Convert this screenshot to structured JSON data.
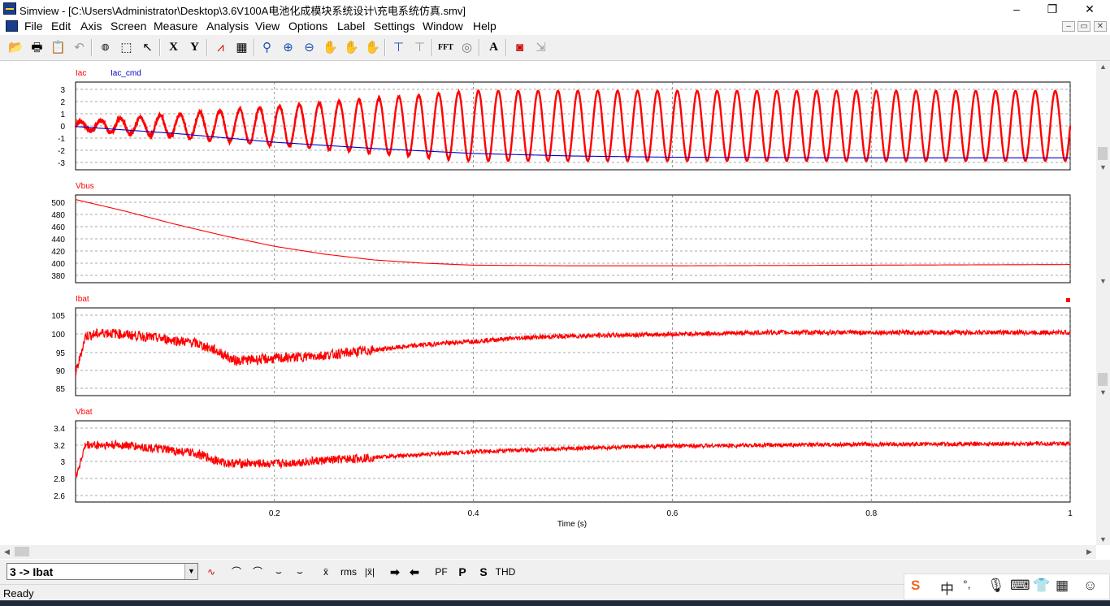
{
  "window": {
    "title": "Simview - [C:\\Users\\Administrator\\Desktop\\3.6V100A电池化成模块系统设计\\充电系统仿真.smv]",
    "minimize": "–",
    "restore": "❐",
    "close": "✕"
  },
  "menu": [
    "File",
    "Edit",
    "Axis",
    "Screen",
    "Measure",
    "Analysis",
    "View",
    "Options",
    "Label",
    "Settings",
    "Window",
    "Help"
  ],
  "mdi_controls": [
    "–",
    "▭",
    "✕"
  ],
  "toolbar": {
    "x_label": "X",
    "y_label": "Y",
    "fft_label": "FFT",
    "text_label": "A"
  },
  "chart_data": [
    {
      "type": "line",
      "title": "",
      "series": [
        {
          "name": "Iac",
          "color": "#ff0000",
          "description": "sinusoid, amplitude rises from ~0.3 to ~2.8 over 0-0.4 s then steady",
          "frequency_hz": 50,
          "amplitude_start": 0.3,
          "amplitude_end": 2.8
        },
        {
          "name": "Iac_cmd",
          "color": "#0000cc",
          "points": [
            [
              0,
              -0.05
            ],
            [
              0.1,
              -0.6
            ],
            [
              0.2,
              -1.3
            ],
            [
              0.3,
              -1.8
            ],
            [
              0.4,
              -2.2
            ],
            [
              0.5,
              -2.4
            ],
            [
              0.6,
              -2.5
            ],
            [
              0.8,
              -2.55
            ],
            [
              1.0,
              -2.55
            ]
          ]
        }
      ],
      "ylim": [
        -3.5,
        3.5
      ],
      "yticks": [
        "3",
        "2",
        "1",
        "0",
        "-1",
        "-2",
        "-3"
      ]
    },
    {
      "type": "line",
      "series": [
        {
          "name": "Vbus",
          "color": "#ff0000",
          "points": [
            [
              0,
              500
            ],
            [
              0.05,
              482
            ],
            [
              0.1,
              462
            ],
            [
              0.15,
              444
            ],
            [
              0.2,
              428
            ],
            [
              0.25,
              416
            ],
            [
              0.3,
              407
            ],
            [
              0.35,
              402
            ],
            [
              0.4,
              399
            ],
            [
              0.5,
              398
            ],
            [
              0.6,
              398
            ],
            [
              0.8,
              399
            ],
            [
              1.0,
              400
            ]
          ]
        }
      ],
      "ylim": [
        372,
        507
      ],
      "yticks": [
        "500",
        "480",
        "460",
        "440",
        "420",
        "400",
        "380"
      ]
    },
    {
      "type": "line",
      "series": [
        {
          "name": "Ibat",
          "color": "#ff0000",
          "points": [
            [
              0,
              88
            ],
            [
              0.01,
              99
            ],
            [
              0.03,
              100
            ],
            [
              0.08,
              98.5
            ],
            [
              0.12,
              97
            ],
            [
              0.14,
              95
            ],
            [
              0.16,
              92
            ],
            [
              0.2,
              92.5
            ],
            [
              0.25,
              93.5
            ],
            [
              0.3,
              95
            ],
            [
              0.35,
              96.5
            ],
            [
              0.4,
              97.5
            ],
            [
              0.45,
              98.5
            ],
            [
              0.5,
              99
            ],
            [
              0.6,
              99.5
            ],
            [
              0.7,
              100
            ],
            [
              0.8,
              100
            ],
            [
              1.0,
              100
            ]
          ]
        }
      ],
      "ylim": [
        82,
        107
      ],
      "yticks": [
        "105",
        "100",
        "95",
        "90",
        "85"
      ]
    },
    {
      "type": "line",
      "series": [
        {
          "name": "Vbat",
          "color": "#ff0000",
          "points": [
            [
              0,
              2.8
            ],
            [
              0.01,
              3.2
            ],
            [
              0.05,
              3.2
            ],
            [
              0.12,
              3.1
            ],
            [
              0.15,
              2.98
            ],
            [
              0.2,
              2.97
            ],
            [
              0.3,
              3.05
            ],
            [
              0.4,
              3.12
            ],
            [
              0.5,
              3.16
            ],
            [
              0.6,
              3.19
            ],
            [
              0.7,
              3.2
            ],
            [
              0.8,
              3.21
            ],
            [
              1.0,
              3.22
            ]
          ]
        }
      ],
      "ylim": [
        2.5,
        3.5
      ],
      "yticks": [
        "3.4",
        "3.2",
        "3",
        "2.8",
        "2.6"
      ]
    }
  ],
  "x_axis": {
    "xlabel": "Time (s)",
    "xlim": [
      0,
      1.0
    ],
    "ticks": [
      "0.2",
      "0.4",
      "0.6",
      "0.8",
      "1"
    ],
    "grid": true
  },
  "bottom_bar": {
    "selected_trace": "3 -> Ibat",
    "mean_label": "x̄",
    "rms_label": "rms",
    "abs_mean_label": "|x̄|",
    "pf_label": "PF",
    "p_label": "P",
    "s_label": "S",
    "thd_label": "THD"
  },
  "status": "Ready",
  "ime": {
    "lang": "中",
    "punct": "°,"
  }
}
